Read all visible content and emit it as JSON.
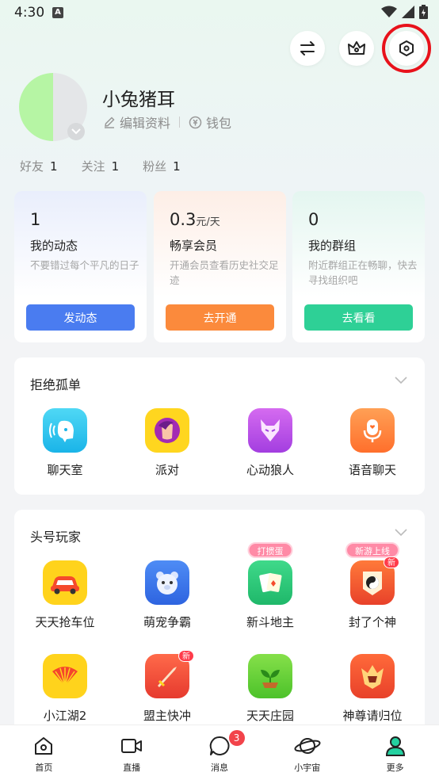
{
  "status": {
    "time": "4:30",
    "notif_letter": "A"
  },
  "top_actions": [
    "switch-icon",
    "crown-icon",
    "settings-icon"
  ],
  "profile": {
    "name": "小兔猪耳",
    "edit_label": "编辑资料",
    "wallet_label": "钱包"
  },
  "stats": [
    {
      "label": "好友",
      "value": "1"
    },
    {
      "label": "关注",
      "value": "1"
    },
    {
      "label": "粉丝",
      "value": "1"
    }
  ],
  "cards": [
    {
      "num": "1",
      "unit": "",
      "title": "我的动态",
      "desc": "不要错过每个平凡的日子",
      "button": "发动态",
      "color": "#4a7cf0"
    },
    {
      "num": "0.3",
      "unit": "元/天",
      "title": "畅享会员",
      "desc": "开通会员查看历史社交足迹",
      "button": "去开通",
      "color": "#fb8a3c"
    },
    {
      "num": "0",
      "unit": "",
      "title": "我的群组",
      "desc": "附近群组正在畅聊，快去寻找组织吧",
      "button": "去看看",
      "color": "#2ed096"
    }
  ],
  "section1": {
    "title": "拒绝孤单",
    "apps": [
      {
        "label": "聊天室",
        "icon": "chatroom-icon"
      },
      {
        "label": "派对",
        "icon": "party-icon"
      },
      {
        "label": "心动狼人",
        "icon": "werewolf-icon"
      },
      {
        "label": "语音聊天",
        "icon": "voice-chat-icon"
      }
    ]
  },
  "section2": {
    "title": "头号玩家",
    "apps": [
      {
        "label": "天天抢车位",
        "icon": "car-icon",
        "pill": "",
        "new": ""
      },
      {
        "label": "萌宠争霸",
        "icon": "pet-bear-icon",
        "pill": "",
        "new": ""
      },
      {
        "label": "新斗地主",
        "icon": "cards-icon",
        "pill": "打掼蛋",
        "new": ""
      },
      {
        "label": "封了个神",
        "icon": "taiji-icon",
        "pill": "新游上线",
        "new": "新"
      },
      {
        "label": "小江湖2",
        "icon": "fan-icon",
        "pill": "",
        "new": ""
      },
      {
        "label": "盟主快冲",
        "icon": "sword-icon",
        "pill": "",
        "new": "新"
      },
      {
        "label": "天天庄园",
        "icon": "plant-icon",
        "pill": "",
        "new": ""
      },
      {
        "label": "神尊请归位",
        "icon": "warrior-icon",
        "pill": "",
        "new": ""
      }
    ]
  },
  "bottom_nav": [
    {
      "label": "首页",
      "icon": "home-icon"
    },
    {
      "label": "直播",
      "icon": "live-icon"
    },
    {
      "label": "消息",
      "icon": "message-icon",
      "badge": "3"
    },
    {
      "label": "小宇宙",
      "icon": "planet-icon"
    },
    {
      "label": "更多",
      "icon": "more-person-icon"
    }
  ]
}
